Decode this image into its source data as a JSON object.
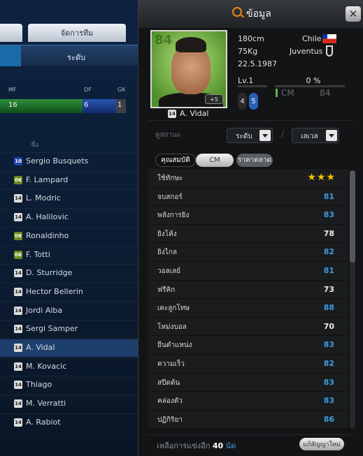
{
  "background": {
    "tabs": [
      {
        "label": ""
      },
      {
        "label": "จัดการทีม"
      }
    ],
    "subtab": {
      "label": "ระดับ"
    },
    "positions": [
      {
        "label": "MF",
        "value": "16",
        "color": "#1a7a2a"
      },
      {
        "label": "DF",
        "value": "6",
        "color": "#1a3f8f"
      },
      {
        "label": "GK",
        "value": "1",
        "color": "#444444"
      }
    ],
    "name_header": "ชื่อ",
    "players": [
      {
        "badge": "10",
        "name": "Sergio Busquets",
        "active": false
      },
      {
        "badge": "06",
        "name": "F. Lampard",
        "active": false
      },
      {
        "badge": "14",
        "name": "L. Modric",
        "active": false
      },
      {
        "badge": "14",
        "name": "A. Halilovic",
        "active": false
      },
      {
        "badge": "06",
        "name": "Ronaldinho",
        "active": false
      },
      {
        "badge": "06",
        "name": "F. Totti",
        "active": false
      },
      {
        "badge": "14",
        "name": "D. Sturridge",
        "active": false
      },
      {
        "badge": "14",
        "name": "Hector Bellerin",
        "active": false
      },
      {
        "badge": "14",
        "name": "Jordi Alba",
        "active": false
      },
      {
        "badge": "14",
        "name": "Sergi Samper",
        "active": false
      },
      {
        "badge": "14",
        "name": "A. Vidal",
        "active": true
      },
      {
        "badge": "14",
        "name": "M. Kovacic",
        "active": false
      },
      {
        "badge": "14",
        "name": "Thiago",
        "active": false
      },
      {
        "badge": "14",
        "name": "M. Verratti",
        "active": false
      },
      {
        "badge": "14",
        "name": "A. Rabiot",
        "active": false
      }
    ]
  },
  "modal": {
    "title": "ข้อมูล",
    "close_label": "✕",
    "player": {
      "ovr": "84",
      "plus": "+5",
      "badge": "14",
      "name": "A. Vidal",
      "height": "180cm",
      "weight": "75Kg",
      "birth": "22.5.1987",
      "nation": "Chile",
      "club": "Juventus"
    },
    "level": {
      "label": "Lv.1",
      "left": "4",
      "right": "5"
    },
    "progress": {
      "label": "0 %",
      "value": 0
    },
    "position": {
      "name": "CM",
      "value": "84"
    },
    "filter": {
      "label": "ดูสถานะ",
      "dd1": "ระดับ",
      "slash": "/",
      "dd2": "เลเวล"
    },
    "tabs": {
      "attributes": "คุณสมบัติ",
      "position": "CM",
      "price": "ราคาตลาด"
    },
    "skill": {
      "name": "ใช้ทักษะ",
      "stars": "★★★"
    },
    "stats": [
      {
        "name": "จบสกอร์",
        "value": "81",
        "color": "blue"
      },
      {
        "name": "พลังการยิง",
        "value": "83",
        "color": "blue"
      },
      {
        "name": "ยิงโค้ง",
        "value": "78",
        "color": "white"
      },
      {
        "name": "ยิงไกล",
        "value": "82",
        "color": "blue"
      },
      {
        "name": "วอลเลย์",
        "value": "81",
        "color": "blue"
      },
      {
        "name": "ฟรีคิก",
        "value": "73",
        "color": "white"
      },
      {
        "name": "เตะลูกโทษ",
        "value": "88",
        "color": "blue"
      },
      {
        "name": "โหม่งบอล",
        "value": "70",
        "color": "white"
      },
      {
        "name": "ยืนตำแหน่ง",
        "value": "83",
        "color": "blue"
      },
      {
        "name": "ความเร็ว",
        "value": "82",
        "color": "blue"
      },
      {
        "name": "สปีดต้น",
        "value": "83",
        "color": "blue"
      },
      {
        "name": "คล่องตัว",
        "value": "83",
        "color": "blue"
      },
      {
        "name": "ปฏิกิริยา",
        "value": "86",
        "color": "blue"
      }
    ],
    "footer": {
      "prefix": "เหลือการแข่งอีก",
      "count": "40",
      "unit": "นัด",
      "renew": "แก้สัญญาใหม่"
    }
  },
  "colors": {
    "accent_blue": "#3d9be0",
    "star": "#f2c200",
    "title_icon": "#e88a1a"
  }
}
